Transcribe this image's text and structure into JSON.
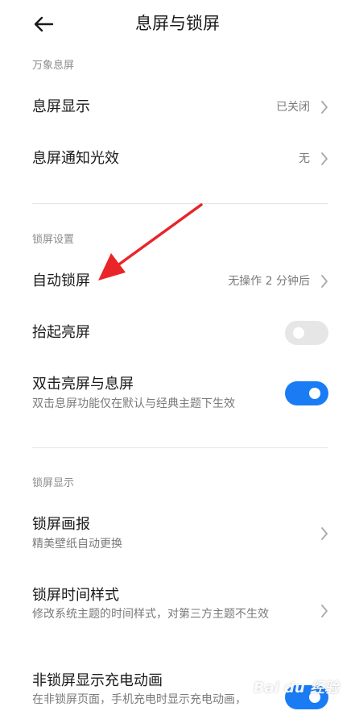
{
  "header": {
    "title": "息屏与锁屏",
    "back_icon": "arrow-left-icon"
  },
  "sections": {
    "aod": {
      "title": "万象息屏"
    },
    "lock": {
      "title": "锁屏设置"
    },
    "lock_display": {
      "title": "锁屏显示"
    }
  },
  "rows": {
    "aod_display": {
      "title": "息屏显示",
      "value": "已关闭"
    },
    "aod_notify": {
      "title": "息屏通知光效",
      "value": "无"
    },
    "auto_lock": {
      "title": "自动锁屏",
      "value": "无操作 2 分钟后"
    },
    "raise_wake": {
      "title": "抬起亮屏",
      "enabled": false
    },
    "double_tap": {
      "title": "双击亮屏与息屏",
      "subtitle": "双击息屏功能仅在默认与经典主题下生效",
      "enabled": true
    },
    "wallpaper": {
      "title": "锁屏画报",
      "subtitle": "精美壁纸自动更换"
    },
    "clock_style": {
      "title": "锁屏时间样式",
      "subtitle": "修改系统主题的时间样式，对第三方主题不生效"
    },
    "charge_anim": {
      "title": "非锁屏显示充电动画",
      "subtitle": "在非锁屏页面，手机充电时显示充电动画，"
    }
  },
  "colors": {
    "accent": "#1a7cf5",
    "arrow": "#e8262a",
    "toggle_off": "#e6e6e6"
  },
  "watermark": {
    "text": "Bai du 经验"
  }
}
